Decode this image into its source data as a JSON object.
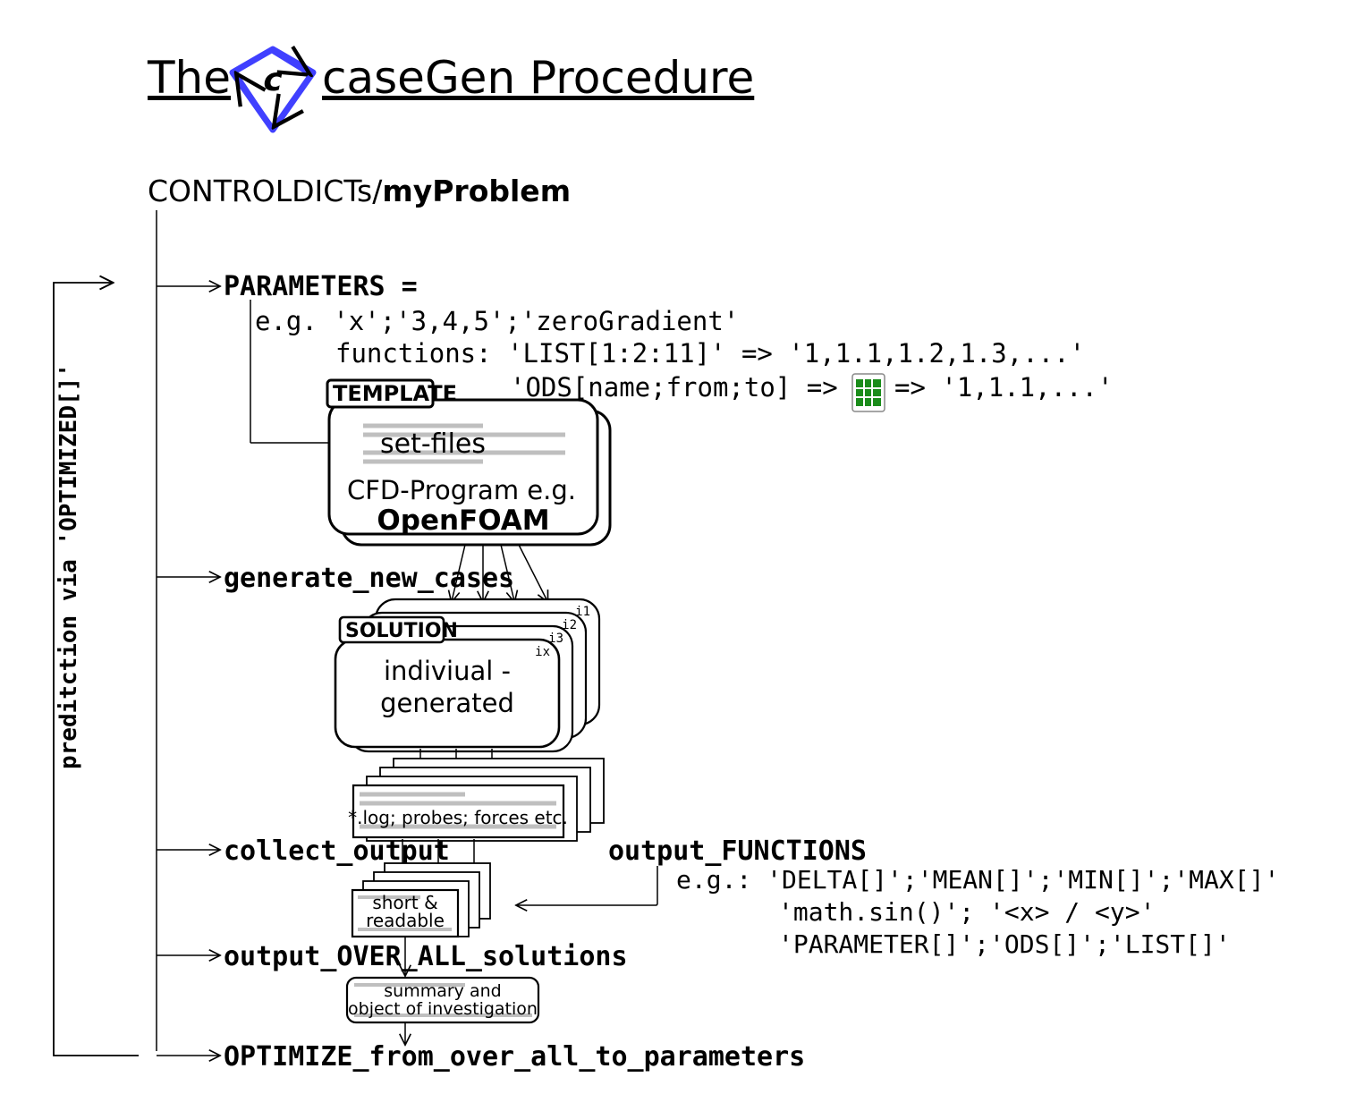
{
  "title": {
    "pre": "The ",
    "post": " caseGen Procedure"
  },
  "root": {
    "prefix": "CONTROLDICTs/",
    "name": "myProblem"
  },
  "params_heading": "PARAMETERS =",
  "params_example_prefix": "e.g. ",
  "params_example": "'x';'3,4,5';'zeroGradient'",
  "functions_label": "functions: ",
  "list_expr": "'LIST[1:2:11]' => '1,1.1,1.2,1.3,...'",
  "ods_left": "'ODS[name;from;to] =>",
  "ods_right": " => '1,1.1,...'",
  "template_label": "TEMPLATE",
  "setfiles": "set-files",
  "cfd_line": "CFD-Program e.g.",
  "cfd_name": "OpenFOAM",
  "generate": "generate_new_cases",
  "solution_label": "SOLUTION",
  "solution_i1": "i1",
  "solution_i2": "i2",
  "solution_i3": "i3",
  "solution_ix": "ix",
  "individual1": "indiviual -",
  "individual2": "generated",
  "logs": "*.log; probes; forces etc.",
  "collect": "collect_output",
  "short1": "short &",
  "short2": "readable",
  "output_functions_title": "output_FUNCTIONS",
  "of_eg": "e.g.: ",
  "of_line1": "'DELTA[]';'MEAN[]';'MIN[]';'MAX[]'",
  "of_line2": "'math.sin()'; '<x> / <y>'",
  "of_line3": "'PARAMETER[]';'ODS[]';'LIST[]'",
  "over_all": "output_OVER_ALL_solutions",
  "summary1": "summary and",
  "summary2": "object of investigation",
  "optimize": "OPTIMIZE_from_over_all_to_parameters",
  "side_label": "preditction via 'OPTIMIZED[]'"
}
